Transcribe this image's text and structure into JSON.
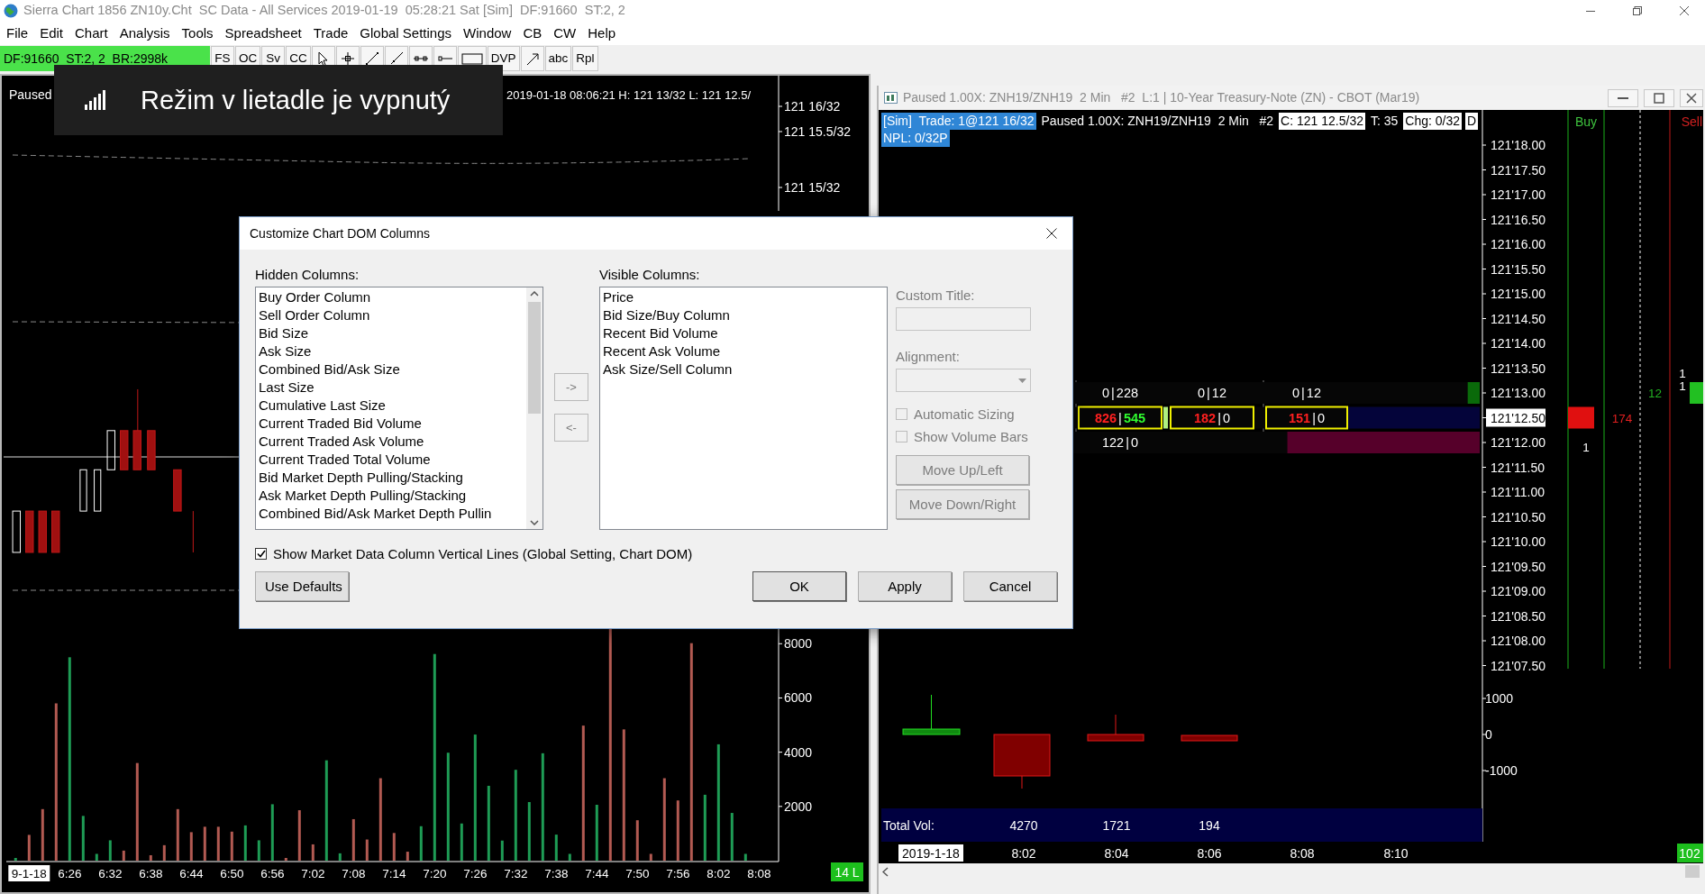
{
  "window": {
    "title": "Sierra Chart 1856 ZN10y.Cht  SC Data - All Services 2019-01-19  05:28:21 Sat [Sim]  DF:91660  ST:2, 2"
  },
  "menu": [
    "File",
    "Edit",
    "Chart",
    "Analysis",
    "Tools",
    "Spreadsheet",
    "Trade",
    "Global Settings",
    "Window",
    "CB",
    "CW",
    "Help"
  ],
  "toolbar": {
    "status": "DF:91660  ST:2, 2  BR:2998k",
    "buttons": [
      {
        "kind": "text",
        "label": "FS"
      },
      {
        "kind": "text",
        "label": "OC"
      },
      {
        "kind": "text",
        "label": "Sv"
      },
      {
        "kind": "text",
        "label": "CC"
      },
      {
        "kind": "pointer"
      },
      {
        "kind": "crosshair"
      },
      {
        "kind": "line"
      },
      {
        "kind": "ray"
      },
      {
        "kind": "segment"
      },
      {
        "kind": "hray"
      },
      {
        "kind": "rectangle"
      },
      {
        "kind": "text",
        "label": "DVP"
      },
      {
        "kind": "arrow"
      },
      {
        "kind": "text",
        "label": "abc"
      },
      {
        "kind": "text",
        "label": "Rpl"
      }
    ]
  },
  "notification": {
    "text": "Režim v lietadle je vypnutý"
  },
  "left_chart": {
    "status": "Paused",
    "header": "2019-01-18 08:06:21 H: 121 13/32 L: 121 12.5/",
    "price_labels": [
      "121 16/32",
      "121 15.5/32",
      "121 15/32"
    ],
    "badge": "14 L",
    "volume": {
      "chart_data": {
        "type": "bar",
        "ylim": [
          0,
          11000
        ],
        "yticks": [
          2000,
          4000,
          6000,
          8000
        ],
        "categories": [
          null,
          "9-1-18",
          null,
          null,
          "6:26",
          null,
          null,
          "6:32",
          null,
          null,
          "6:38",
          null,
          null,
          "6:44",
          null,
          null,
          "6:50",
          null,
          null,
          "6:56",
          null,
          null,
          "7:02",
          null,
          null,
          "7:08",
          null,
          null,
          "7:14",
          null,
          null,
          "7:20",
          null,
          null,
          "7:26",
          null,
          null,
          "7:32",
          null,
          null,
          "7:38",
          null,
          null,
          "7:44",
          null,
          null,
          "7:50",
          null,
          null,
          "7:56",
          null,
          null,
          "8:02",
          null,
          null,
          "8:08"
        ],
        "series": [
          {
            "color": "#1e9c55",
            "values": [
              100,
              null,
              null,
              null,
              7500,
              1650,
              250,
              750,
              null,
              null,
              null,
              null,
              null,
              null,
              null,
              null,
              null,
              1300,
              750,
              2080,
              null,
              null,
              null,
              3700,
              270,
              null,
              null,
              null,
              null,
              null,
              1270,
              7620,
              3980,
              1370,
              4650,
              2760,
              740,
              3350,
              2160,
              3960,
              960,
              250,
              null,
              2060,
              null,
              null,
              null,
              null,
              null,
              null,
              null,
              2430,
              4290,
              1760,
              250,
              null
            ]
          },
          {
            "color": "#b25a52",
            "values": [
              null,
              950,
              1900,
              5800,
              null,
              null,
              null,
              null,
              370,
              3600,
              200,
              570,
              1900,
              1050,
              1250,
              1250,
              1070,
              null,
              null,
              null,
              100,
              1860,
              600,
              null,
              null,
              1530,
              780,
              3040,
              1020,
              330,
              null,
              null,
              null,
              null,
              null,
              null,
              null,
              null,
              null,
              null,
              null,
              null,
              4980,
              null,
              8600,
              4840,
              1490,
              250,
              3040,
              2220,
              8020,
              null,
              null,
              null,
              null,
              null
            ]
          }
        ]
      }
    }
  },
  "right_window": {
    "title": "Paused 1.00X: ZNH19/ZNH19  2 Min   #2  L:1 | 10-Year Treasury-Note (ZN) - CBOT (Mar19)",
    "info_lines": [
      [
        {
          "text": "[Sim]  Trade: 1@121 16/32",
          "kind": "highlight"
        },
        {
          "text": "Paused 1.00X: ZNH19/ZNH19  2 Min   #2",
          "kind": "plain"
        },
        {
          "text": "C: 121 12.5/32",
          "kind": "boxed"
        },
        {
          "text": "T: 35",
          "kind": "plain"
        },
        {
          "text": "Chg: 0/32",
          "kind": "boxed"
        },
        {
          "text": "D",
          "kind": "boxed"
        }
      ],
      [
        {
          "text": "NPL: 0/32P",
          "kind": "highlight"
        }
      ]
    ],
    "separator": "|",
    "columns": {
      "buy": "Buy",
      "sell": "Sell"
    },
    "ladder": [
      {
        "price": "121'18.00",
        "selected": false
      },
      {
        "price": "121'17.50",
        "selected": false
      },
      {
        "price": "121'17.00",
        "selected": false
      },
      {
        "price": "121'16.50",
        "selected": false
      },
      {
        "price": "121'16.00",
        "selected": false
      },
      {
        "price": "121'15.50",
        "selected": false
      },
      {
        "price": "121'15.00",
        "selected": false
      },
      {
        "price": "121'14.50",
        "selected": false
      },
      {
        "price": "121'14.00",
        "selected": false
      },
      {
        "price": "121'13.50",
        "selected": false,
        "sell": {
          "text": "1",
          "marker": false
        }
      },
      {
        "price": "121'13.00",
        "selected": false,
        "dom": [
          {
            "parts": [
              {
                "text": "0"
              },
              {
                "text": "228"
              }
            ],
            "boxed": false
          },
          {
            "parts": [
              {
                "text": "0"
              },
              {
                "text": "12"
              }
            ],
            "boxed": false
          },
          {
            "parts": [
              {
                "text": "0"
              },
              {
                "text": "12"
              }
            ],
            "boxed": false
          }
        ],
        "depth_bar": {
          "kind": "ask",
          "level": 0.02
        },
        "column_3": {
          "text": "12",
          "color": "#22b022"
        },
        "sell": {
          "text": "1",
          "marker": true
        }
      },
      {
        "price": "121'12.50",
        "selected": true,
        "dom": [
          {
            "parts": [
              {
                "text": "826",
                "color": "#ff2020"
              },
              {
                "text": "545",
                "color": "#30ff30"
              }
            ],
            "boxed": true
          },
          {
            "parts": [
              {
                "text": "182",
                "color": "#ff2020"
              },
              {
                "text": "0"
              }
            ],
            "boxed": true
          },
          {
            "parts": [
              {
                "text": "151",
                "color": "#ff2020"
              },
              {
                "text": "0"
              }
            ],
            "boxed": true
          }
        ],
        "depth_bar": {
          "kind": "current",
          "level": 0.22
        },
        "buy": {
          "marker": true
        },
        "column_2": {
          "text": "174",
          "color": "#e02020"
        }
      },
      {
        "price": "121'12.00",
        "selected": false,
        "dom": [
          {
            "parts": [
              {
                "text": "122"
              },
              {
                "text": "0"
              }
            ],
            "boxed": false
          }
        ],
        "depth_bar": {
          "kind": "bid",
          "level": 0.32
        },
        "buy": {
          "text": "1",
          "marker": false
        }
      },
      {
        "price": "121'11.50",
        "selected": false
      },
      {
        "price": "121'11.00",
        "selected": false
      },
      {
        "price": "121'10.50",
        "selected": false
      },
      {
        "price": "121'10.00",
        "selected": false
      },
      {
        "price": "121'09.50",
        "selected": false
      },
      {
        "price": "121'09.00",
        "selected": false
      },
      {
        "price": "121'08.50",
        "selected": false
      },
      {
        "price": "121'08.00",
        "selected": false
      },
      {
        "price": "121'07.50",
        "selected": false
      }
    ],
    "delta_axis": [
      "1000",
      "0",
      "-1000"
    ],
    "total_vol": {
      "label": "Total Vol:",
      "values": [
        "4270",
        "1721",
        "194"
      ]
    },
    "time_labels": [
      "2019-1-18",
      "8:02",
      "8:04",
      "8:06",
      "8:08",
      "8:10"
    ],
    "badge": "102"
  },
  "dialog": {
    "title": "Customize Chart DOM Columns",
    "hidden_label": "Hidden Columns:",
    "hidden_columns": [
      "Buy Order Column",
      "Sell Order Column",
      "Bid Size",
      "Ask Size",
      "Combined Bid/Ask Size",
      "Last Size",
      "Cumulative Last Size",
      "Current Traded Bid Volume",
      "Current Traded Ask Volume",
      "Current Traded Total Volume",
      "Bid Market Depth Pulling/Stacking",
      "Ask Market Depth Pulling/Stacking",
      "Combined Bid/Ask Market Depth Pullin"
    ],
    "visible_label": "Visible Columns:",
    "visible_columns": [
      "Price",
      "Bid Size/Buy Column",
      "Recent Bid Volume",
      "Recent Ask Volume",
      "Ask Size/Sell Column"
    ],
    "move_arrows": [
      {
        "label": "->",
        "disabled": true
      },
      {
        "label": "<-",
        "disabled": true
      }
    ],
    "custom_title": {
      "label": "Custom Title:",
      "disabled": true
    },
    "alignment": {
      "label": "Alignment:",
      "disabled": true
    },
    "options": [
      {
        "label": "Automatic Sizing",
        "checked": false,
        "disabled": true
      },
      {
        "label": "Show Volume Bars",
        "checked": false,
        "disabled": true
      }
    ],
    "move_buttons": [
      {
        "label": "Move Up/Left",
        "disabled": true
      },
      {
        "label": "Move Down/Right",
        "disabled": true
      }
    ],
    "vertical_lines": {
      "label": "Show Market Data Column Vertical Lines (Global Setting, Chart DOM)",
      "checked": true
    },
    "buttons": [
      {
        "label": "Use Defaults",
        "kind": "left"
      },
      {
        "label": "OK",
        "kind": "default"
      },
      {
        "label": "Apply",
        "kind": "right"
      },
      {
        "label": "Cancel",
        "kind": "right"
      }
    ]
  }
}
